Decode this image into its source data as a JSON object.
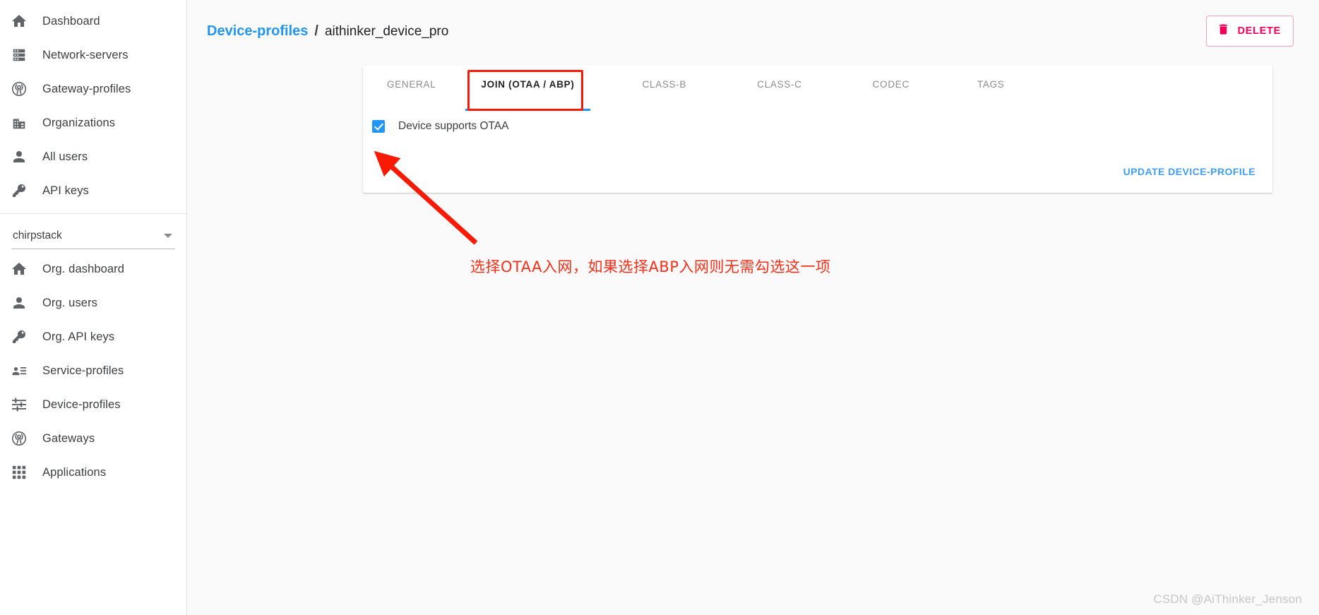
{
  "sidebar": {
    "global_items": [
      {
        "label": "Dashboard",
        "icon": "home-icon"
      },
      {
        "label": "Network-servers",
        "icon": "server-icon"
      },
      {
        "label": "Gateway-profiles",
        "icon": "antenna-icon"
      },
      {
        "label": "Organizations",
        "icon": "building-icon"
      },
      {
        "label": "All users",
        "icon": "person-icon"
      },
      {
        "label": "API keys",
        "icon": "key-icon"
      }
    ],
    "org_select": {
      "value": "chirpstack",
      "options": [
        "chirpstack"
      ]
    },
    "org_items": [
      {
        "label": "Org. dashboard",
        "icon": "home-icon"
      },
      {
        "label": "Org. users",
        "icon": "person-icon"
      },
      {
        "label": "Org. API keys",
        "icon": "key-icon"
      },
      {
        "label": "Service-profiles",
        "icon": "contact-list-icon"
      },
      {
        "label": "Device-profiles",
        "icon": "sliders-icon"
      },
      {
        "label": "Gateways",
        "icon": "antenna-icon"
      },
      {
        "label": "Applications",
        "icon": "apps-grid-icon"
      }
    ]
  },
  "header": {
    "breadcrumb_root": "Device-profiles",
    "breadcrumb_separator": "/",
    "breadcrumb_current": "aithinker_device_pro",
    "delete_label": "DELETE"
  },
  "card": {
    "tabs": [
      {
        "label": "GENERAL",
        "active": false
      },
      {
        "label": "JOIN (OTAA / ABP)",
        "active": true
      },
      {
        "label": "CLASS-B",
        "active": false
      },
      {
        "label": "CLASS-C",
        "active": false
      },
      {
        "label": "CODEC",
        "active": false
      },
      {
        "label": "TAGS",
        "active": false
      }
    ],
    "checkbox_label": "Device supports OTAA",
    "checkbox_checked": true,
    "update_label": "UPDATE DEVICE-PROFILE"
  },
  "annotations": {
    "note_text": "选择OTAA入网，如果选择ABP入网则无需勾选这一项",
    "note_color": "#fa2d16",
    "highlight_color": "#f91a05"
  },
  "watermark": "CSDN @AiThinker_Jenson",
  "colors": {
    "accent_blue": "#2196f3",
    "delete_pink": "#f50057",
    "link_blue": "#3f9ef5",
    "annotation_red": "#fa2d16"
  }
}
